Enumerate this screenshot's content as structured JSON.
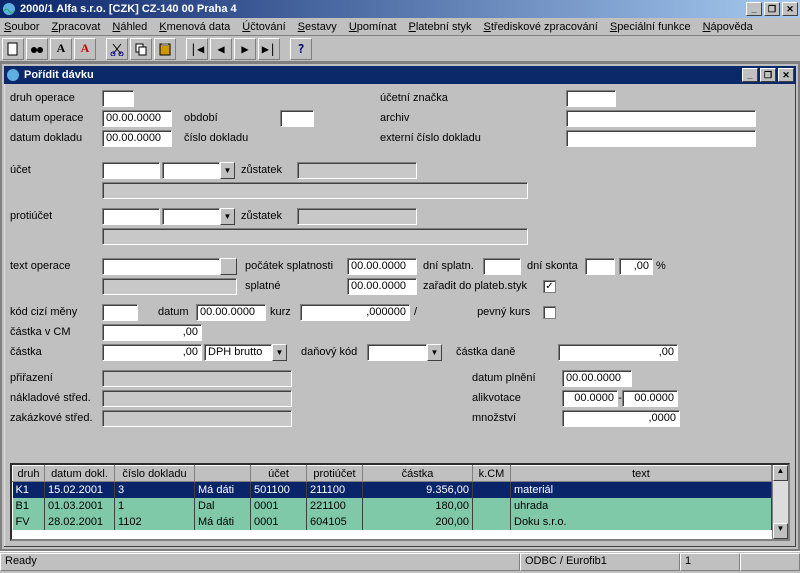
{
  "app": {
    "title": "2000/1  Alfa s.r.o.  [CZK] CZ-140 00  Praha 4"
  },
  "menu": {
    "items": [
      "Soubor",
      "Zpracovat",
      "Náhled",
      "Kmenová data",
      "Účtování",
      "Sestavy",
      "Upomínat",
      "Platební styk",
      "Střediskové zpracování",
      "Speciální funkce",
      "Nápověda"
    ]
  },
  "child": {
    "title": "Pořídit dávku"
  },
  "labels": {
    "druh_operace": "druh operace",
    "ucetni_znacka": "účetní značka",
    "datum_operace": "datum operace",
    "obdobi": "období",
    "archiv": "archiv",
    "datum_dokladu": "datum dokladu",
    "cislo_dokladu": "číslo dokladu",
    "externi_cislo": "externí číslo dokladu",
    "ucet": "účet",
    "zustatek": "zůstatek",
    "protiucet": "protiúčet",
    "text_operace": "text operace",
    "pocatek_spl": "počátek splatnosti",
    "dni_splatn": "dní splatn.",
    "dni_skonta": "dní skonta",
    "splatne": "splatné",
    "zaradit": "zařadit do plateb.styk",
    "kod_meny": "kód cizí měny",
    "datum": "datum",
    "kurz": "kurz",
    "pevny_kurs": "pevný kurs",
    "castka_cm": "částka v CM",
    "castka": "částka",
    "danovy_kod": "daňový kód",
    "castka_dane": "částka daně",
    "prirazeni": "přiřazení",
    "datum_plneni": "datum plnění",
    "naklad_stred": "nákladové střed.",
    "alikvotace": "alikvotace",
    "zakaz_stred": "zakázkové střed.",
    "mnozstvi": "množství",
    "dph_brutto": "DPH brutto",
    "percent": "%",
    "slash": "/",
    "dash": "-"
  },
  "values": {
    "datum_operace": "00.00.0000",
    "datum_dokladu": "00.00.0000",
    "pocatek_spl": "00.00.0000",
    "splatne": "00.00.0000",
    "datum_meny": "00.00.0000",
    "kurz": ",000000",
    "castka_cm": ",00",
    "castka": ",00",
    "castka_dane": ",00",
    "skonto_pct": ",00",
    "datum_plneni": "00.00.0000",
    "alikv_from": "00.0000",
    "alikv_to": "00.0000",
    "mnozstvi": ",0000",
    "zaradit_checked": "✓"
  },
  "grid": {
    "headers": [
      "druh",
      "datum dokl.",
      "číslo dokladu",
      "",
      "účet",
      "protiúčet",
      "částka",
      "k.CM",
      "text"
    ],
    "rows": [
      {
        "druh": "K1",
        "datum": "15.02.2001",
        "cislo": "3",
        "md": "Má dáti",
        "ucet": "501100",
        "proti": "211100",
        "castka": "9.356,00",
        "kcm": "",
        "text": "materiál"
      },
      {
        "druh": "B1",
        "datum": "01.03.2001",
        "cislo": "1",
        "md": "Dal",
        "ucet": "0001",
        "proti": "221100",
        "castka": "180,00",
        "kcm": "",
        "text": "uhrada"
      },
      {
        "druh": "FV",
        "datum": "28.02.2001",
        "cislo": "1102",
        "md": "Má dáti",
        "ucet": "0001",
        "proti": "604105",
        "castka": "200,00",
        "kcm": "",
        "text": "Doku s.r.o."
      }
    ]
  },
  "status": {
    "left": "Ready",
    "mid": "ODBC / Eurofib1",
    "right": "1"
  }
}
